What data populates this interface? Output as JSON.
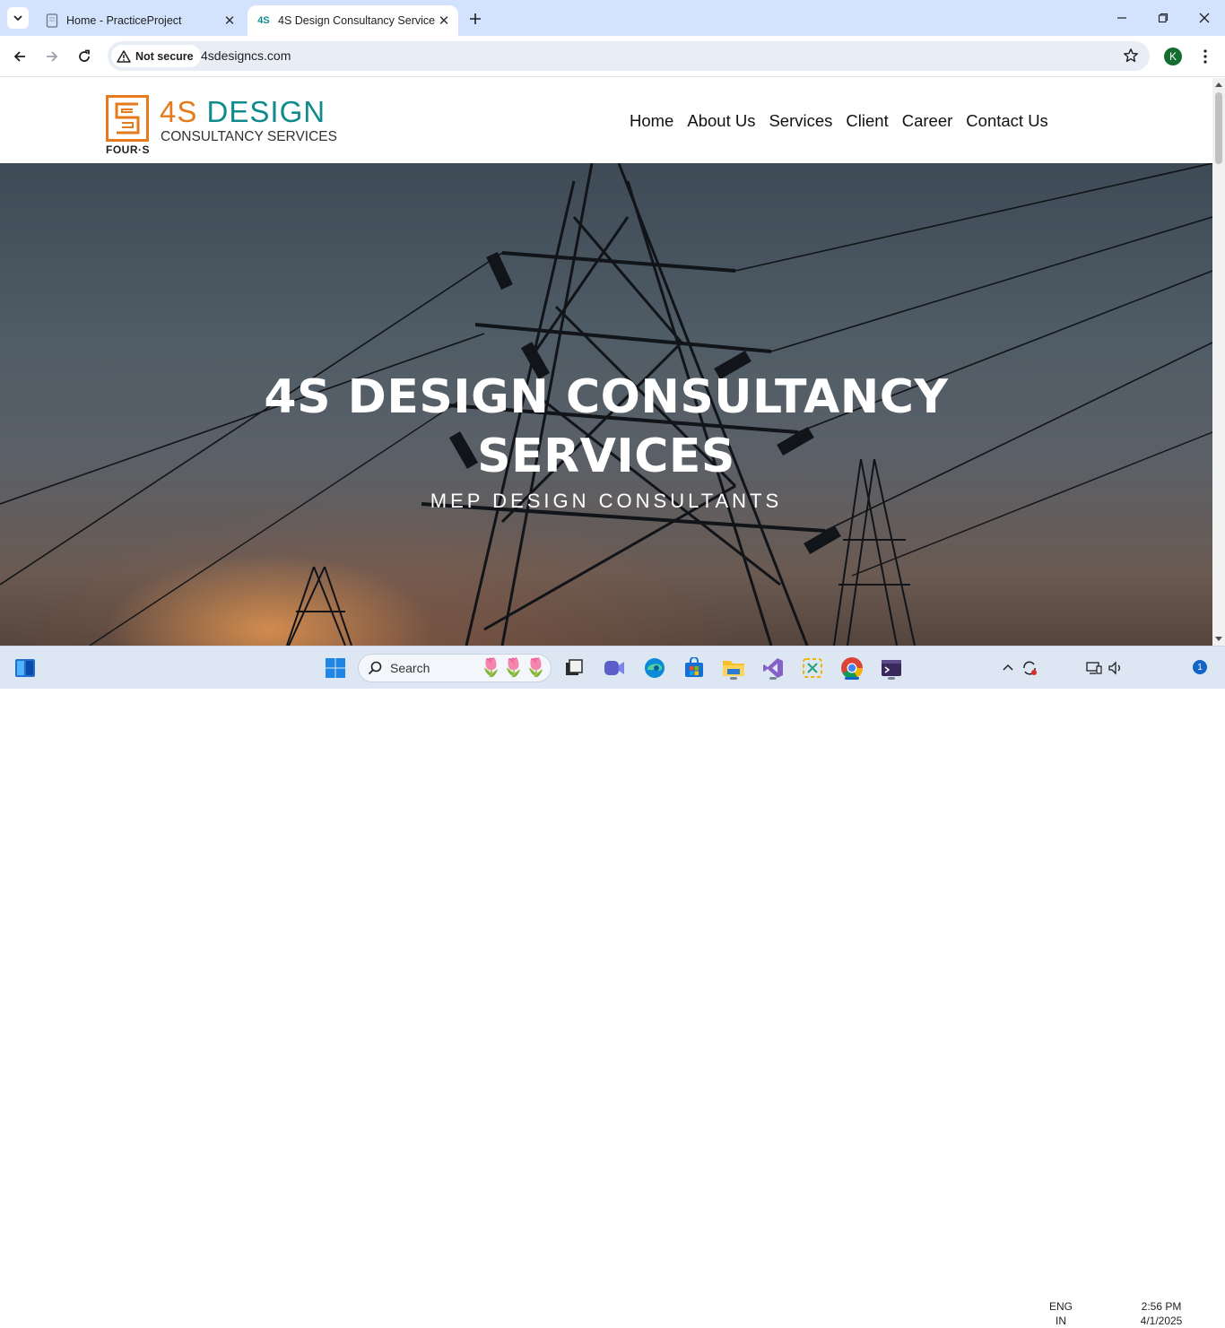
{
  "browser": {
    "tabs": [
      {
        "title": "Home - PracticeProject",
        "active": false,
        "favicon": "document-icon"
      },
      {
        "title": "4S Design Consultancy Services",
        "active": true,
        "favicon_text": "4S"
      }
    ],
    "security_label": "Not secure",
    "url": "4sdesigncs.com",
    "profile_initial": "K"
  },
  "site": {
    "logo": {
      "word_4s": "4S",
      "word_design": "DESIGN",
      "subtitle": "CONSULTANCY SERVICES",
      "mark_caption": "FOUR·S"
    },
    "nav": [
      "Home",
      "About Us",
      "Services",
      "Client",
      "Career",
      "Contact Us"
    ],
    "hero": {
      "title_line1": "4S DESIGN CONSULTANCY",
      "title_line2": "SERVICES",
      "subtitle": "MEP DESIGN CONSULTANTS"
    },
    "colors": {
      "teal": "#0f8b8d",
      "orange": "#e57b1c"
    }
  },
  "taskbar": {
    "search_label": "Search",
    "language_line1": "ENG",
    "language_line2": "IN",
    "time": "2:56 PM",
    "date": "4/1/2025",
    "notification_count": "1"
  }
}
